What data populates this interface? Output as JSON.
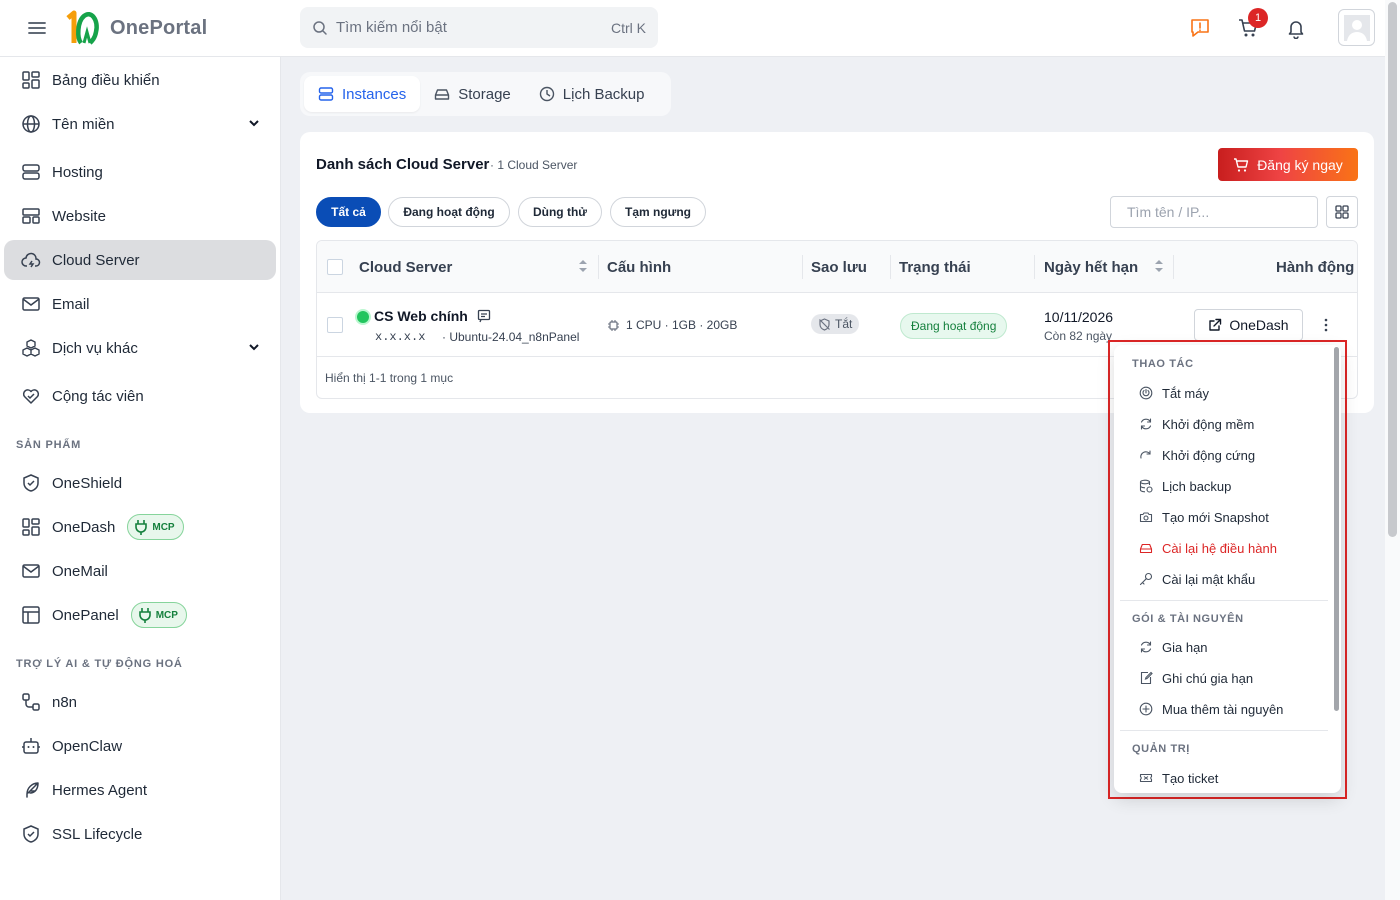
{
  "app": {
    "name": "OnePortal",
    "logo_mark": "1Ω"
  },
  "topbar": {
    "search_placeholder": "Tìm kiếm nổi bật",
    "search_shortcut": "Ctrl K",
    "cart_count": "1"
  },
  "sidebar": {
    "main": [
      {
        "label": "Bảng điều khiển",
        "icon": "dashboard-icon"
      },
      {
        "label": "Tên miền",
        "icon": "globe-icon",
        "expandable": true
      },
      {
        "label": "Hosting",
        "icon": "server-icon"
      },
      {
        "label": "Website",
        "icon": "website-icon"
      },
      {
        "label": "Cloud Server",
        "icon": "cloud-icon",
        "active": true
      },
      {
        "label": "Email",
        "icon": "mail-icon"
      },
      {
        "label": "Dịch vụ khác",
        "icon": "boxes-icon",
        "expandable": true
      },
      {
        "label": "Cộng tác viên",
        "icon": "handshake-icon"
      }
    ],
    "section_products": "SẢN PHẨM",
    "products": [
      {
        "label": "OneShield",
        "icon": "shield-icon"
      },
      {
        "label": "OneDash",
        "icon": "dashboard-icon",
        "badge": "MCP"
      },
      {
        "label": "OneMail",
        "icon": "mail-icon"
      },
      {
        "label": "OnePanel",
        "icon": "panel-icon",
        "badge": "MCP"
      }
    ],
    "section_ai": "TRỢ LÝ AI & TỰ ĐỘNG HOÁ",
    "ai": [
      {
        "label": "n8n",
        "icon": "workflow-icon"
      },
      {
        "label": "OpenClaw",
        "icon": "bot-icon"
      },
      {
        "label": "Hermes Agent",
        "icon": "feather-icon"
      },
      {
        "label": "SSL Lifecycle",
        "icon": "shield-check-icon"
      }
    ]
  },
  "tabs": [
    {
      "label": "Instances",
      "active": true
    },
    {
      "label": "Storage"
    },
    {
      "label": "Lịch Backup"
    }
  ],
  "card": {
    "title": "Danh sách Cloud Server",
    "subtitle": "· 1 Cloud Server",
    "register_label": "Đăng ký ngay",
    "filters": [
      "Tất cả",
      "Đang hoạt động",
      "Dùng thử",
      "Tạm ngưng"
    ],
    "search_placeholder": "Tìm tên / IP...",
    "columns": [
      "Cloud Server",
      "Cấu hình",
      "Sao lưu",
      "Trạng thái",
      "Ngày hết hạn",
      "Hành động"
    ],
    "rows": [
      {
        "name": "CS Web chính",
        "ip": "x.x.x.x",
        "os": "· Ubuntu-24.04_n8nPanel",
        "spec": "1 CPU · 1GB · 20GB",
        "backup": "Tắt",
        "status": "Đang hoạt động",
        "expiry": "10/11/2026",
        "remaining": "Còn 82 ngày",
        "action": "OneDash"
      }
    ],
    "footer": "Hiển thị 1-1 trong 1 mục"
  },
  "menu": {
    "sections": [
      {
        "title": "THAO TÁC",
        "items": [
          {
            "label": "Tắt máy",
            "icon": "power-icon"
          },
          {
            "label": "Khởi động mềm",
            "icon": "refresh-icon"
          },
          {
            "label": "Khởi động cứng",
            "icon": "redo-icon"
          },
          {
            "label": "Lịch backup",
            "icon": "database-icon"
          },
          {
            "label": "Tạo mới Snapshot",
            "icon": "camera-icon"
          },
          {
            "label": "Cài lại hệ điều hành",
            "icon": "hard-drive-icon",
            "danger": true
          },
          {
            "label": "Cài lại mật khẩu",
            "icon": "key-icon"
          }
        ]
      },
      {
        "title": "GÓI & TÀI NGUYÊN",
        "items": [
          {
            "label": "Gia hạn",
            "icon": "renew-icon"
          },
          {
            "label": "Ghi chú gia hạn",
            "icon": "edit-note-icon"
          },
          {
            "label": "Mua thêm tài nguyên",
            "icon": "plus-circle-icon"
          }
        ]
      },
      {
        "title": "QUẢN TRỊ",
        "items": [
          {
            "label": "Tạo ticket",
            "icon": "ticket-icon"
          }
        ]
      }
    ]
  },
  "colors": {
    "accent": "#2563eb",
    "filter_active": "#0a4db6",
    "danger": "#dc2626",
    "success": "#15803d",
    "highlight_border": "#dc2626"
  }
}
